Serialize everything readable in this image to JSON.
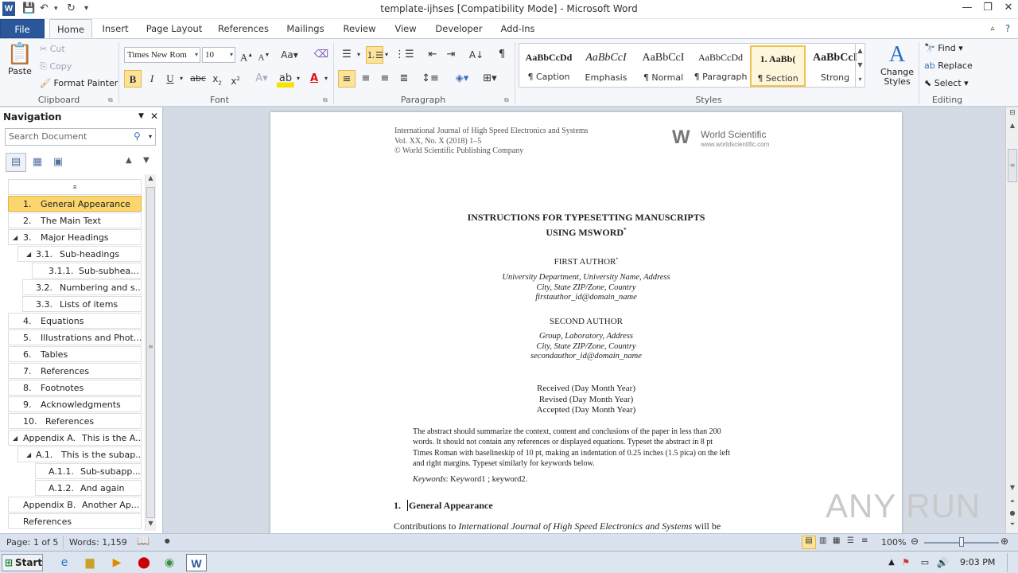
{
  "window": {
    "title": "template-ijhses [Compatibility Mode]  -  Microsoft Word",
    "app_icon": "W"
  },
  "tabs": [
    "File",
    "Home",
    "Insert",
    "Page Layout",
    "References",
    "Mailings",
    "Review",
    "View",
    "Developer",
    "Add-Ins"
  ],
  "clipboard": {
    "paste": "Paste",
    "cut": "Cut",
    "copy": "Copy",
    "format_painter": "Format Painter",
    "label": "Clipboard"
  },
  "font": {
    "name": "Times New Rom",
    "size": "10",
    "label": "Font"
  },
  "paragraph": {
    "label": "Paragraph"
  },
  "styles": {
    "label": "Styles",
    "items": [
      {
        "preview": "AaBbCcDd",
        "name": "¶ Caption"
      },
      {
        "preview": "AaBbCcI",
        "name": "Emphasis"
      },
      {
        "preview": "AaBbCcI",
        "name": "¶ Normal"
      },
      {
        "preview": "AaBbCcDd",
        "name": "¶ Paragraph"
      },
      {
        "preview": "1.   AaBb(",
        "name": "¶ Section"
      },
      {
        "preview": "AaBbCcI",
        "name": "Strong"
      }
    ],
    "change_styles": "Change Styles"
  },
  "editing": {
    "label": "Editing",
    "find": "Find",
    "replace": "Replace",
    "select": "Select"
  },
  "nav": {
    "title": "Navigation",
    "search_placeholder": "Search Document",
    "items": [
      {
        "num": "1.",
        "text": "General Appearance"
      },
      {
        "num": "2.",
        "text": "The Main Text"
      },
      {
        "num": "3.",
        "text": "Major Headings"
      },
      {
        "num": "3.1.",
        "text": "Sub-headings"
      },
      {
        "num": "3.1.1.",
        "text": "Sub-subhea..."
      },
      {
        "num": "3.2.",
        "text": "Numbering and s..."
      },
      {
        "num": "3.3.",
        "text": "Lists of items"
      },
      {
        "num": "4.",
        "text": "Equations"
      },
      {
        "num": "5.",
        "text": "Illustrations and Phot..."
      },
      {
        "num": "6.",
        "text": "Tables"
      },
      {
        "num": "7.",
        "text": "References"
      },
      {
        "num": "8.",
        "text": "Footnotes"
      },
      {
        "num": "9.",
        "text": "Acknowledgments"
      },
      {
        "num": "10.",
        "text": "References"
      },
      {
        "num": "Appendix A.",
        "text": "This is the A..."
      },
      {
        "num": "A.1.",
        "text": "This is the subap..."
      },
      {
        "num": "A.1.1.",
        "text": "Sub-subapp..."
      },
      {
        "num": "A.1.2.",
        "text": "And again"
      },
      {
        "num": "Appendix B.",
        "text": "Another Ap..."
      },
      {
        "num": "",
        "text": "References"
      }
    ]
  },
  "doc": {
    "journal_line1": "International Journal of High Speed Electronics and Systems",
    "journal_line2": "Vol. XX, No. X (2018) 1–5",
    "journal_line3": "© World Scientific Publishing Company",
    "publisher_name": "World Scientific",
    "publisher_url": "www.worldscientific.com",
    "title1": "INSTRUCTIONS  FOR TYPESETTING  MANUSCRIPTS",
    "title2": "USING  MSWORD",
    "title_mark": "*",
    "author1": "FIRST AUTHOR",
    "author1_mark": "*",
    "aff1_1": "University Department, University Name, Address",
    "aff1_2": "City, State ZIP/Zone, Country",
    "aff1_3": "firstauthor_id@domain_name",
    "author2": "SECOND AUTHOR",
    "aff2_1": "Group, Laboratory, Address",
    "aff2_2": "City, State ZIP/Zone, Country",
    "aff2_3": "secondauthor_id@domain_name",
    "received": "Received (Day Month Year)",
    "revised": "Revised (Day Month Year)",
    "accepted": "Accepted (Day Month Year)",
    "abstract_1": "The abstract should summarize the context, content and conclusions of the paper in less than 200",
    "abstract_2": "words. It should not contain any references or displayed equations. Typeset the abstract in 8 pt",
    "abstract_3": "Times Roman with baselineskip of 10 pt, making an indentation of 0.25 inches (1.5 pica) on the left",
    "abstract_4": "and right margins. Typeset similarly for keywords below.",
    "keywords_label": "Keywords",
    "keywords": ": Keyword1 ; keyword2.",
    "section_num": "1.",
    "section_title": "General Appearance",
    "body_1a": "Contributions to ",
    "body_1b": "International Journal of High Speed Electronics and Systems",
    "body_1c": " will be"
  },
  "status": {
    "page": "Page: 1 of 5",
    "words": "Words: 1,159",
    "zoom": "100%"
  },
  "taskbar": {
    "start": "Start",
    "time": "9:03 PM"
  },
  "watermark": "ANY RUN"
}
